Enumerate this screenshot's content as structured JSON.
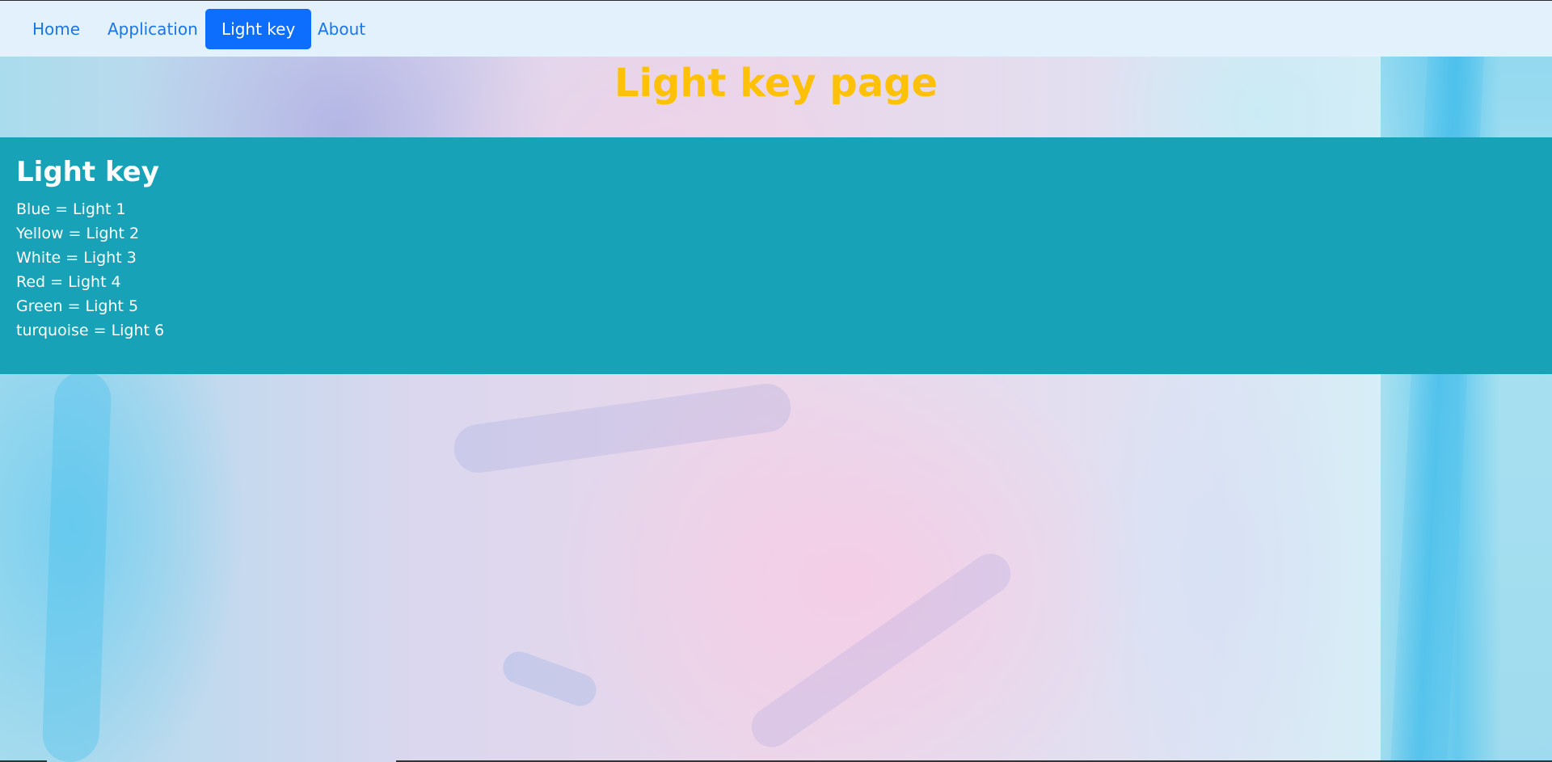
{
  "nav": {
    "items": [
      {
        "label": "Home",
        "active": false
      },
      {
        "label": "Application",
        "active": false
      },
      {
        "label": "Light key",
        "active": true
      },
      {
        "label": "About",
        "active": false
      }
    ]
  },
  "header": {
    "title": "Light key page"
  },
  "key_panel": {
    "heading": "Light key",
    "entries": [
      "Blue = Light 1",
      "Yellow = Light 2",
      "White = Light 3",
      "Red = Light 4",
      "Green = Light 5",
      "turquoise = Light 6"
    ]
  },
  "colors": {
    "navbar_bg": "#e3f1fc",
    "nav_link": "#1a76e8",
    "nav_active_bg": "#0d6efd",
    "title": "#ffc107",
    "panel_bg": "#17a2b8",
    "panel_text": "#ffffff"
  }
}
